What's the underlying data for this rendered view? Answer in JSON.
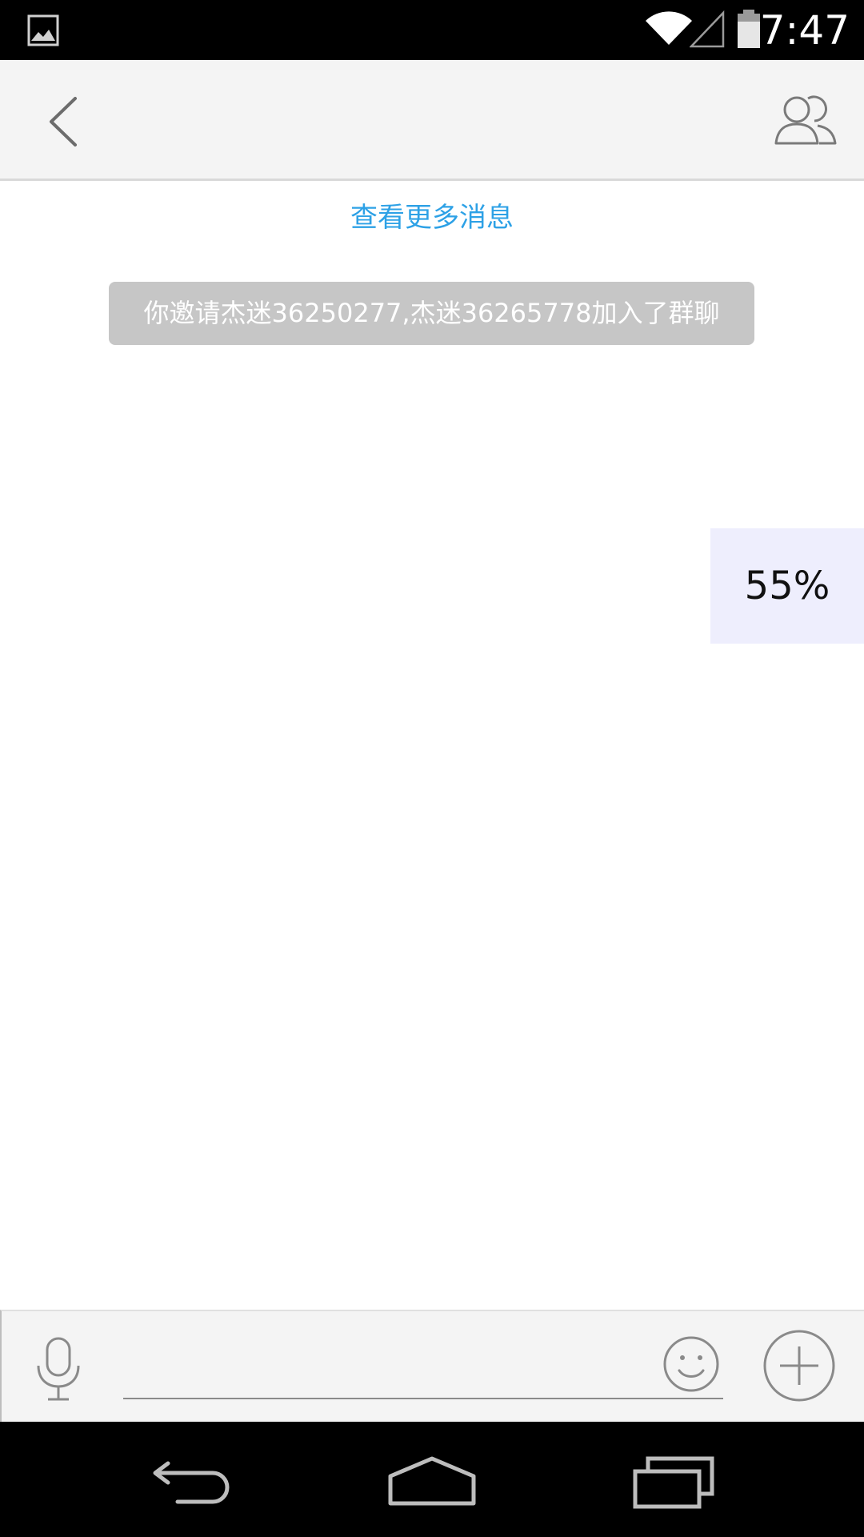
{
  "status_bar": {
    "time": "7:47",
    "icons": [
      "gallery-icon",
      "wifi-icon",
      "signal-icon",
      "battery-icon"
    ]
  },
  "header": {
    "back_icon": "chevron-left-icon",
    "group_icon": "group-members-icon"
  },
  "chat": {
    "load_more_label": "查看更多消息",
    "system_notice": "你邀请杰迷36250277,杰迷36265778加入了群聊"
  },
  "progress": {
    "label": "55%",
    "value": 0.55
  },
  "input_bar": {
    "message_value": "",
    "message_placeholder": "",
    "icons": [
      "microphone-icon",
      "emoji-icon",
      "plus-icon"
    ]
  },
  "nav_bar": {
    "icons": [
      "back-icon",
      "home-icon",
      "recents-icon"
    ]
  },
  "colors": {
    "accent": "#2da1e6",
    "notice_bg": "#c6c6c6",
    "progress_bg": "#eeeefd"
  }
}
